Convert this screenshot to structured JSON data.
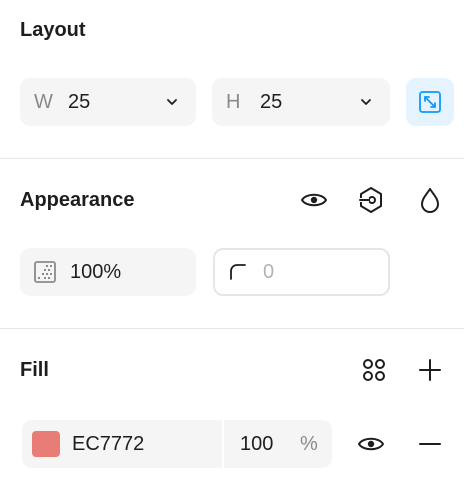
{
  "layout": {
    "title": "Layout",
    "width": {
      "prefix": "W",
      "value": "25"
    },
    "height": {
      "prefix": "H",
      "value": "25"
    },
    "resize_icon": "resize-to-fit-icon"
  },
  "appearance": {
    "title": "Appearance",
    "opacity": {
      "value": "100%",
      "icon": "opacity-grid-icon"
    },
    "corner_radius": {
      "value": "0",
      "icon": "corner-radius-icon"
    },
    "icons": [
      "eye-icon",
      "variable-icon",
      "drop-icon"
    ]
  },
  "fill": {
    "title": "Fill",
    "color_hex": "EC7772",
    "swatch_color": "#E87C77",
    "opacity_value": "100",
    "opacity_unit": "%",
    "icons": [
      "styles-icon",
      "plus-icon",
      "eye-icon",
      "minus-icon"
    ]
  },
  "colors": {
    "accent_bg": "#E5F3FF",
    "accent": "#0D99FF",
    "field_bg": "#F5F5F5",
    "divider": "#E6E6E6"
  }
}
